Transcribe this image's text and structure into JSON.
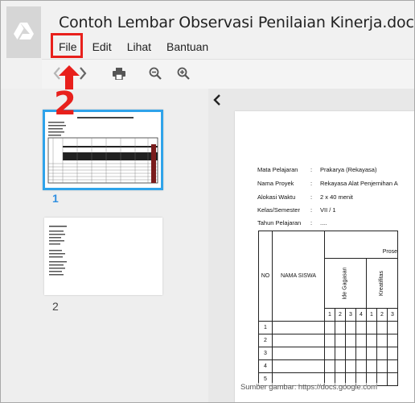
{
  "header": {
    "doc_title": "Contoh Lembar Observasi Penilaian Kinerja.docx"
  },
  "menu": {
    "file": "File",
    "edit": "Edit",
    "view": "Lihat",
    "help": "Bantuan"
  },
  "annotation": {
    "step": "2",
    "color": "#e8201c"
  },
  "toolbar": {
    "icons": [
      "chevron-left-icon",
      "chevron-right-icon",
      "print-icon",
      "zoom-out-icon",
      "zoom-in-icon"
    ]
  },
  "thumbnails": [
    {
      "page": "1",
      "selected": true
    },
    {
      "page": "2",
      "selected": false
    }
  ],
  "document": {
    "meta": [
      {
        "label": "Mata Pelajaran",
        "sep": ":",
        "value": "Prakarya (Rekayasa)"
      },
      {
        "label": "Nama Proyek",
        "sep": ":",
        "value": "Rekayasa Alat Penjernihan A"
      },
      {
        "label": "Alokasi Waktu",
        "sep": ":",
        "value": "2 x 40 menit"
      },
      {
        "label": "Kelas/Semester",
        "sep": ":",
        "value": "VII / 1"
      },
      {
        "label": "Tahun Pelajaran",
        "sep": ":",
        "value": "...."
      }
    ],
    "table": {
      "col_no": "NO",
      "col_name": "NAMA SISWA",
      "group_header": "Prose",
      "aspect_1": "Ide Gagasan",
      "aspect_2": "Kreatifitas",
      "scores": [
        "1",
        "2",
        "3",
        "4",
        "1",
        "2",
        "3"
      ],
      "rows": [
        "1",
        "2",
        "3",
        "4",
        "5"
      ]
    }
  },
  "caption": "Sumber gambar: https://docs.google.com",
  "colors": {
    "selection_blue": "#2fa3ea",
    "page_number_blue": "#2f8fe0"
  }
}
